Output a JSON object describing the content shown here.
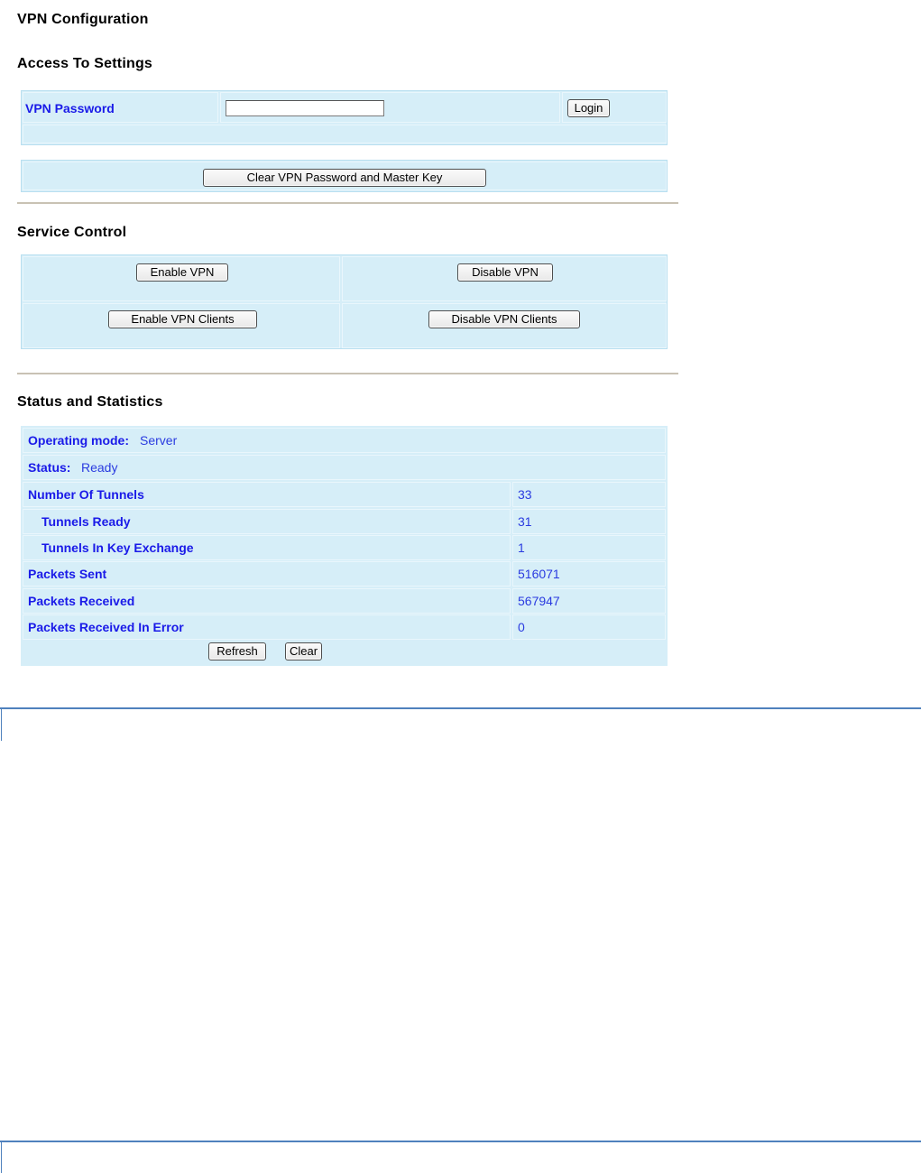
{
  "page": {
    "title": "VPN Configuration"
  },
  "access": {
    "heading": "Access To Settings",
    "password_label": "VPN Password",
    "password_value": "",
    "login_button": "Login",
    "clear_button": "Clear VPN Password and Master Key"
  },
  "service": {
    "heading": "Service Control",
    "enable_vpn": "Enable VPN",
    "disable_vpn": "Disable VPN",
    "enable_clients": "Enable VPN Clients",
    "disable_clients": "Disable VPN Clients"
  },
  "status": {
    "heading": "Status and Statistics",
    "operating_mode_label": "Operating mode:",
    "operating_mode_value": "Server",
    "status_label": "Status:",
    "status_value": "Ready",
    "rows": [
      {
        "label": "Number Of Tunnels",
        "value": "33"
      },
      {
        "label": "Tunnels Ready",
        "value": "31"
      },
      {
        "label": "Tunnels In Key Exchange",
        "value": "1"
      },
      {
        "label": "Packets Sent",
        "value": "516071"
      },
      {
        "label": "Packets Received",
        "value": "567947"
      },
      {
        "label": "Packets Received In Error",
        "value": "0"
      }
    ],
    "refresh_button": "Refresh",
    "clear_button": "Clear"
  },
  "colors": {
    "panel_bg": "#d6eef8",
    "label_blue": "#1a1ae8",
    "divider": "#c9c2b4",
    "page_border": "#4f81bd"
  }
}
